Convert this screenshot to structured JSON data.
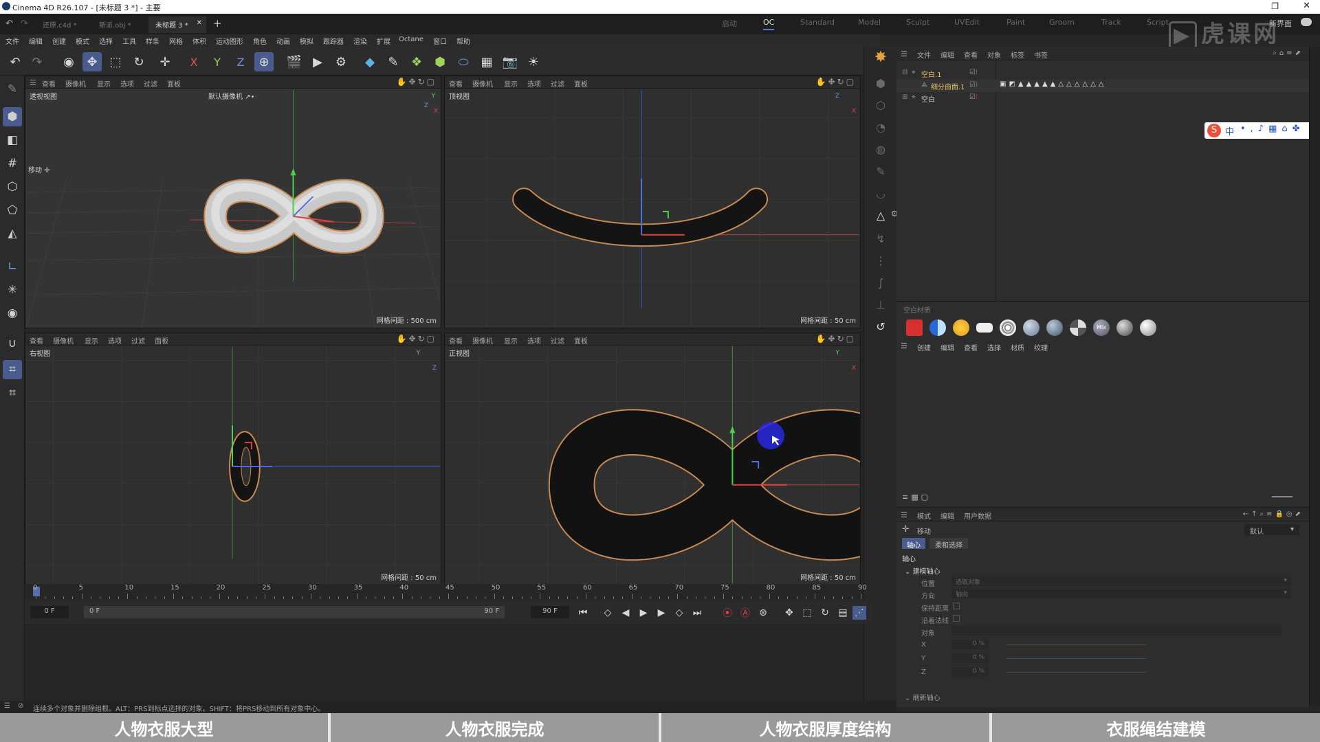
{
  "title": "Cinema 4D R26.107 - [未标题 3 *] - 主要",
  "tabs": [
    {
      "label": "还原.c4d *"
    },
    {
      "label": "斯派.obj *"
    },
    {
      "label": "未标题 3 *"
    }
  ],
  "layouts": [
    "启动",
    "OC",
    "Standard",
    "Model",
    "Sculpt",
    "UVEdit",
    "Paint",
    "Groom",
    "Track",
    "Script"
  ],
  "new_layout": "新界面",
  "menu": [
    "文件",
    "编辑",
    "创建",
    "模式",
    "选择",
    "工具",
    "样条",
    "网格",
    "体积",
    "运动图形",
    "角色",
    "动画",
    "模拟",
    "跟踪器",
    "渲染",
    "扩展",
    "Octane",
    "窗口",
    "帮助"
  ],
  "toolbar_axes": [
    "X",
    "Y",
    "Z"
  ],
  "viewport_menu": [
    "查看",
    "摄像机",
    "显示",
    "选项",
    "过滤",
    "面板"
  ],
  "viewports": [
    {
      "name": "透视视图",
      "camera": "默认摄像机 ↗•",
      "grid": "网格间距 : 500 cm",
      "move_label": "移动 ✛"
    },
    {
      "name": "顶视图",
      "camera": "",
      "grid": "网格间距 : 50 cm"
    },
    {
      "name": "右视图",
      "camera": "",
      "grid": "网格间距 : 50 cm"
    },
    {
      "name": "正视图",
      "camera": "",
      "grid": "网格间距 : 50 cm"
    }
  ],
  "object_panel": {
    "menu": [
      "文件",
      "编辑",
      "查看",
      "对象",
      "标签",
      "书签"
    ],
    "objects": [
      {
        "name": "空白.1",
        "color": "#e0c060"
      },
      {
        "name": "细分曲面.1",
        "color": "#e0c060"
      },
      {
        "name": "空白",
        "color": "#c8c8c8"
      }
    ]
  },
  "ime": {
    "label": "中"
  },
  "material_panel": {
    "header": "空白材质",
    "menu": [
      "创建",
      "编辑",
      "查看",
      "选择",
      "材质",
      "纹理"
    ]
  },
  "attr_panel": {
    "menu": [
      "模式",
      "编辑",
      "用户数据"
    ],
    "tool": "移动",
    "tabs": [
      "轴心",
      "柔和选择"
    ],
    "dropdown": "默认",
    "section": "轴心",
    "subsection": "建模轴心",
    "fields": [
      {
        "label": "位置",
        "value": "选取对象"
      },
      {
        "label": "方向",
        "value": "轴向"
      },
      {
        "label": "保持距离",
        "value": ""
      },
      {
        "label": "沿着法线",
        "value": ""
      },
      {
        "label": "对象",
        "value": ""
      },
      {
        "label": "X",
        "value": "0 %"
      },
      {
        "label": "Y",
        "value": "0 %"
      },
      {
        "label": "Z",
        "value": "0 %"
      }
    ],
    "collapsed": "刷新轴心"
  },
  "timeline": {
    "ticks": [
      "0",
      "5",
      "10",
      "15",
      "20",
      "25",
      "30",
      "35",
      "40",
      "45",
      "50",
      "55",
      "60",
      "65",
      "70",
      "75",
      "80",
      "85",
      "90"
    ],
    "current_frame": "0 F",
    "start_frame": "0 F",
    "end_frame": "90 F",
    "max_frame": "90 F"
  },
  "status": "连续多个对象并删除组根。ALT：PRS到标点选择的对象。SHIFT：将PRS移动到所有对象中心。",
  "bottom_tabs": [
    "人物衣服大型",
    "人物衣服完成",
    "人物衣服厚度结构",
    "衣服绳结建模"
  ],
  "watermark": "虎课网"
}
